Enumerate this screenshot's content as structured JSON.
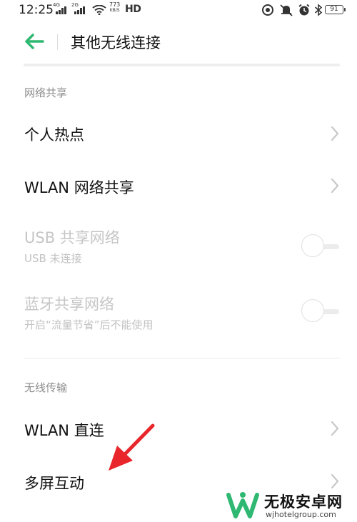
{
  "status_bar": {
    "time": "12:25",
    "sim1_type": "4G",
    "sim2_type": "2G",
    "net_speed_value": "773",
    "net_speed_unit": "KB/S",
    "hd_label": "HD",
    "battery_level": "91",
    "icons": [
      "signal-icon",
      "signal-icon",
      "wifi-icon",
      "hd-icon",
      "data-saver-icon",
      "mute-icon",
      "alarm-icon",
      "bluetooth-icon",
      "battery-icon"
    ]
  },
  "header": {
    "back_icon": "back-arrow-icon",
    "title": "其他无线连接",
    "accent_color": "#2fb872"
  },
  "sections": {
    "network_sharing": {
      "label": "网络共享",
      "items": [
        {
          "title": "个人热点",
          "control": "chevron-right-icon"
        },
        {
          "title": "WLAN 网络共享",
          "control": "chevron-right-icon"
        },
        {
          "title": "USB 共享网络",
          "subtitle": "USB 未连接",
          "control": "toggle",
          "toggle_on": false,
          "enabled": false
        },
        {
          "title": "蓝牙共享网络",
          "subtitle": "开启“流量节省”后不能使用",
          "control": "toggle",
          "toggle_on": false,
          "enabled": false
        }
      ]
    },
    "wireless_transfer": {
      "label": "无线传输",
      "items": [
        {
          "title": "WLAN 直连",
          "control": "chevron-right-icon"
        },
        {
          "title": "多屏互动",
          "control": "chevron-right-icon"
        }
      ]
    }
  },
  "annotation": {
    "icon": "red-arrow-icon",
    "color": "#e8262b"
  },
  "watermark": {
    "logo_icon": "wuji-logo-icon",
    "name": "无极安卓网",
    "url": "wjhotelgroup.com",
    "logo_color": "#2fb872"
  }
}
